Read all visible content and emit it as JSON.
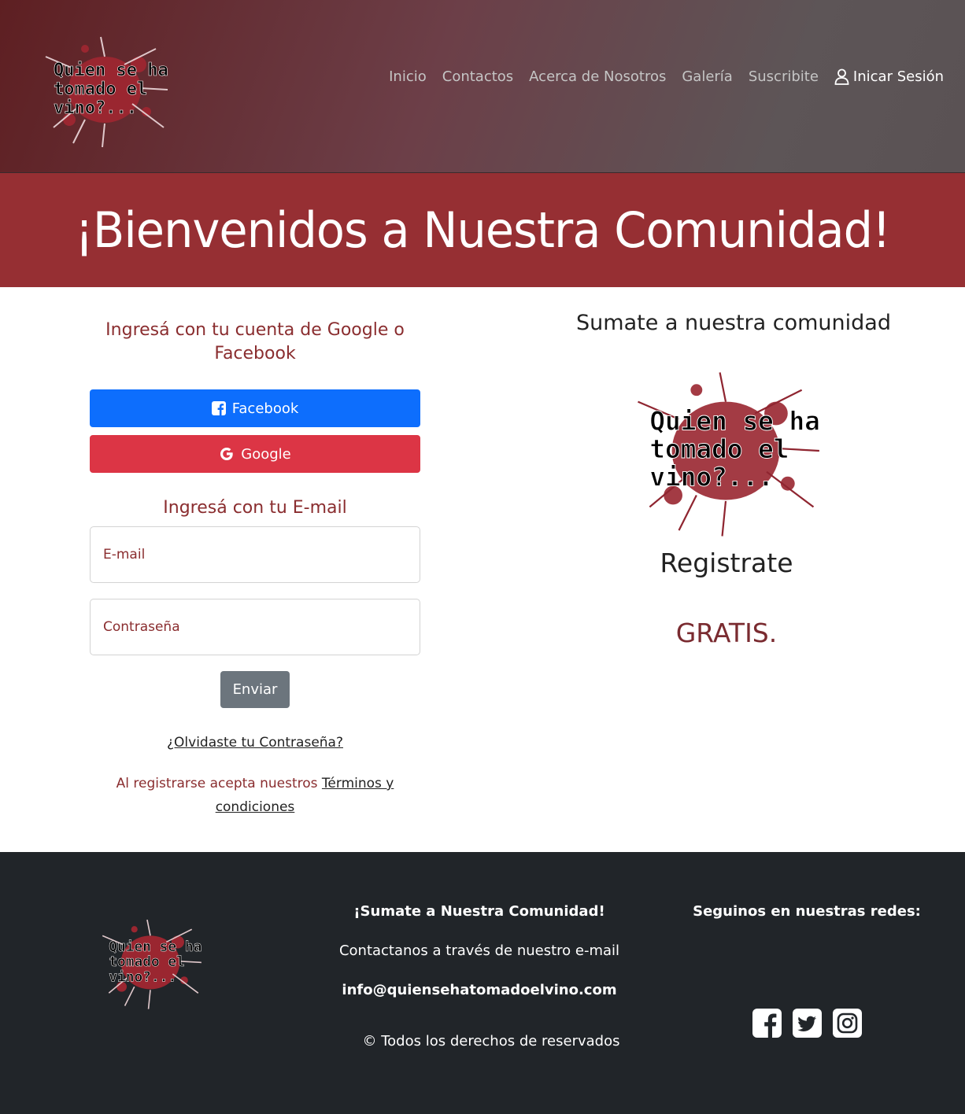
{
  "header": {
    "logo_text": [
      "Quien se ha",
      "tomado el",
      "vino?..."
    ],
    "nav": [
      "Inicio",
      "Contactos",
      "Acerca de Nosotros",
      "Galería",
      "Suscribite"
    ],
    "login_label": "Inicar Sesión"
  },
  "hero": {
    "title": "¡Bienvenidos a Nuestra Comunidad!"
  },
  "login": {
    "social_heading": "Ingresá con tu cuenta de Google o Facebook",
    "facebook_label": "Facebook",
    "google_label": "Google",
    "email_heading": "Ingresá con tu E-mail",
    "email_placeholder": "E-mail",
    "password_placeholder": "Contraseña",
    "submit_label": "Enviar",
    "forgot_label": "¿Olvidaste tu Contraseña?",
    "terms_prefix": "Al registrarse acepta nuestros ",
    "terms_link": "Términos y condiciones"
  },
  "promo": {
    "title": "Sumate a nuestra comunidad",
    "register": "Registrate",
    "free": "GRATIS."
  },
  "footer": {
    "title": "¡Sumate a Nuestra Comunidad!",
    "contact_text": "Contactanos a través de nuestro e-mail",
    "email": "info@quiensehatomadoelvino.com",
    "copyright": "© Todos los derechos de reservados",
    "social_title": "Seguinos en nuestras redes:",
    "social_icons": [
      "facebook-icon",
      "twitter-icon",
      "instagram-icon"
    ]
  },
  "colors": {
    "hero_bg": "#962f33",
    "accent_text": "#8a2d2f",
    "facebook_blue": "#0d6efd",
    "google_red": "#dc3545",
    "footer_bg": "#212529"
  }
}
